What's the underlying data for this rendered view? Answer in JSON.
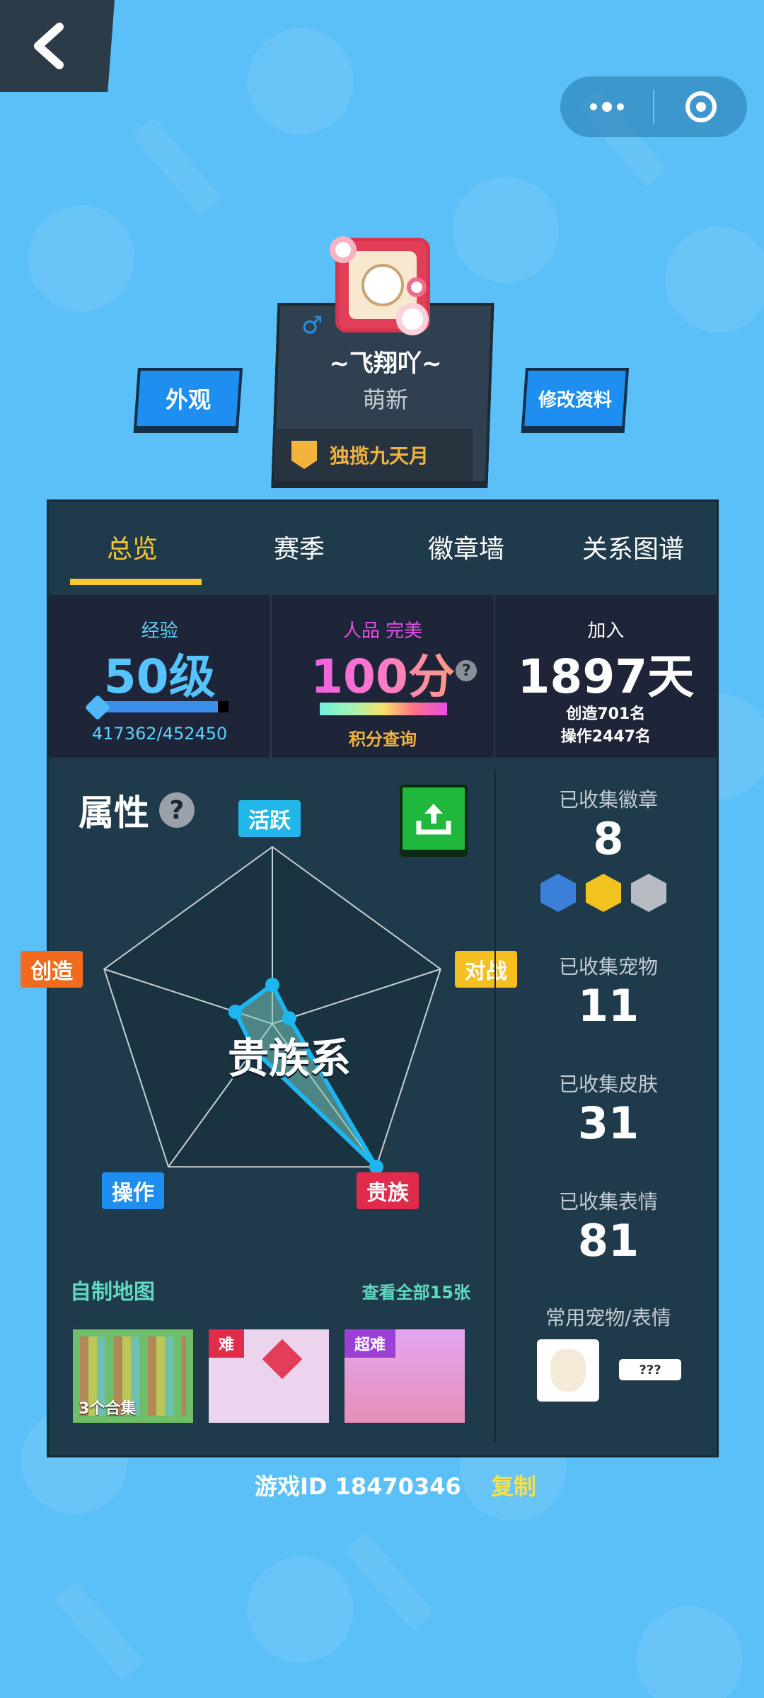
{
  "profile": {
    "nickname": "~飞翔吖~",
    "rank_title": "萌新",
    "gender_symbol": "♂",
    "title_badge": "独揽九天月"
  },
  "buttons": {
    "appearance": "外观",
    "edit_profile": "修改资料"
  },
  "tabs": [
    {
      "label": "总览",
      "active": true
    },
    {
      "label": "赛季",
      "active": false
    },
    {
      "label": "徽章墙",
      "active": false
    },
    {
      "label": "关系图谱",
      "active": false
    }
  ],
  "stats": {
    "exp_label": "经验",
    "exp_level": "50级",
    "exp_progress_text": "417362/452450",
    "exp_progress_fraction": 0.922,
    "rp_label": "人品 完美",
    "rp_value": "100分",
    "rp_help": "?",
    "rp_link": "积分查询",
    "join_label": "加入",
    "join_days": "1897天",
    "create_rank": "创造701名",
    "operate_rank": "操作2447名"
  },
  "attributes": {
    "title": "属性",
    "help": "?",
    "center_label": "贵族系",
    "axes": [
      "活跃",
      "对战",
      "贵族",
      "操作",
      "创造"
    ],
    "axis_colors": [
      "#22b7e8",
      "#f6bf21",
      "#e02b4a",
      "#1e8ef0",
      "#f26a1d"
    ],
    "values": [
      0.22,
      0.1,
      1.0,
      0.18,
      0.22
    ]
  },
  "maps": {
    "title": "自制地图",
    "view_all": "查看全部15张",
    "cards": [
      {
        "badge": "",
        "count": "3个合集"
      },
      {
        "badge": "难",
        "badge_color": "#e02b4a"
      },
      {
        "badge": "超难",
        "badge_color": "#9b3fd6"
      }
    ]
  },
  "collection": {
    "badges_label": "已收集徽章",
    "badges_count": "8",
    "pets_label": "已收集宠物",
    "pets_count": "11",
    "skins_label": "已收集皮肤",
    "skins_count": "31",
    "emotes_label": "已收集表情",
    "emotes_count": "81",
    "favorites_label": "常用宠物/表情",
    "emote_placeholder": "???"
  },
  "footer": {
    "game_id": "游戏ID 18470346",
    "copy": "复制"
  }
}
